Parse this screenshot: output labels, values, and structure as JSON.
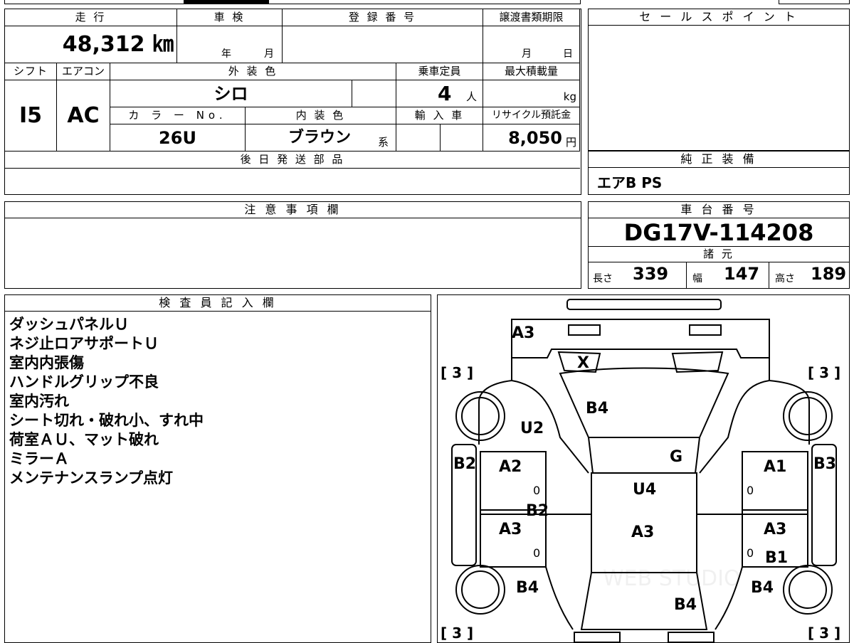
{
  "top_left": {
    "mileage_label": "走 行",
    "mileage_value": "48,312 ㎞",
    "inspection_label": "車 検",
    "inspection_year": "年",
    "inspection_month": "月",
    "reg_label": "登 録 番 号",
    "transfer_label": "譲渡書類期限",
    "transfer_month": "月",
    "transfer_day": "日",
    "shift_label": "シフト",
    "shift_value": "I5",
    "ac_label": "エアコン",
    "ac_value": "AC",
    "exterior_label": "外 装 色",
    "exterior_value": "シロ",
    "capacity_label": "乗車定員",
    "capacity_value": "4",
    "capacity_unit": "人",
    "maxload_label": "最大積載量",
    "maxload_unit": "kg",
    "colorno_label": "カ ラ ー No.",
    "colorno_value": "26U",
    "interior_label": "内 装 色",
    "interior_value": "ブラウン",
    "interior_suffix": "系",
    "import_label": "輸 入 車",
    "recycle_label": "リサイクル預託金",
    "recycle_value": "8,050",
    "recycle_unit": "円",
    "later_parts_label": "後 日 発 送 部 品"
  },
  "sales_point": {
    "label": "セ ー ル ス ポ イ ン ト"
  },
  "genuine_equipment": {
    "label": "純 正 装 備",
    "value": "エアB PS"
  },
  "notes": {
    "label": "注 意 事 項 欄"
  },
  "chassis": {
    "label": "車 台 番 号",
    "value": "DG17V-114208",
    "specs_label": "諸 元",
    "length_label": "長さ",
    "length_value": "339",
    "width_label": "幅",
    "width_value": "147",
    "height_label": "高さ",
    "height_value": "189"
  },
  "inspector": {
    "label": "検 査 員 記 入 欄",
    "lines": [
      "ダッシュパネルＵ",
      "ネジ止ロアサポートＵ",
      "室内内張傷",
      "ハンドルグリップ不良",
      "室内汚れ",
      "シート切れ・破れ小、すれ中",
      "荷室ＡＵ、マット破れ",
      "ミラーＡ",
      "メンテナンスランプ点灯"
    ]
  },
  "diagram": {
    "marks": {
      "front_bumper": "A3",
      "windshield": "X",
      "hood": "B4",
      "left_front_fender": "U2",
      "roof_front": "G",
      "left_front_door": "A2",
      "right_front_door": "A1",
      "left_sill": "B2",
      "right_sill": "B3",
      "roof": "U4",
      "pillar_left": "B2",
      "left_rear_door": "A3",
      "roof_rear": "A3",
      "right_rear_door": "A3",
      "right_rear_panel": "B1",
      "left_rear_fender": "B4",
      "right_rear_fender": "B4",
      "rear_gate": "B4"
    },
    "tire_marks": {
      "front_left": "[ 3 ]",
      "front_right": "[ 3 ]",
      "rear_left": "[ 3 ]",
      "rear_right": "[ 3 ]"
    },
    "door_zeros": "0",
    "watermark": "WEB STUDIO"
  }
}
